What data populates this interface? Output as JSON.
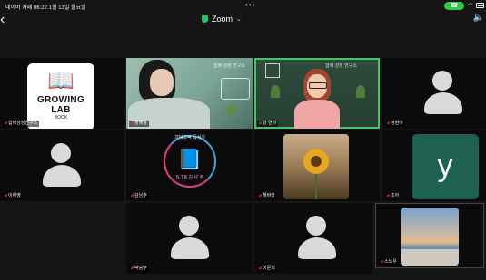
{
  "status_bar": {
    "left": "네이버 카페   06:22   1월 13일 월요일",
    "dots": "•••",
    "call": "☎"
  },
  "header": {
    "back": "‹",
    "app_title": "Zoom",
    "chevron": "⌄",
    "speaker_icon": "speaker-icon"
  },
  "participants": [
    {
      "name": "함께성장연구소",
      "muted": true
    },
    {
      "name": "정해율",
      "muted": true,
      "room_label": "함께 성장 연구소"
    },
    {
      "name": "강 연아",
      "muted": true,
      "room_label": "함께 성장 연구소",
      "active_speaker": true
    },
    {
      "name": "정현아",
      "muted": true
    },
    {
      "name": "이하영",
      "muted": true
    },
    {
      "name": "김남주",
      "muted": true
    },
    {
      "name": "해바라",
      "muted": true
    },
    {
      "name": "조아",
      "muted": true
    },
    {
      "name": "박승주",
      "muted": true
    },
    {
      "name": "이문희",
      "muted": true
    },
    {
      "name": "스노우",
      "muted": true
    }
  ],
  "growing_lab": {
    "icon": "open-book-icon",
    "title": "GROWING LAB",
    "subtitle": "BOOK"
  },
  "ntb_logo": {
    "top": "끄덕끄덕 독서기",
    "bottom": "N.T.B 김 남 주",
    "icon": "reading-person-icon"
  },
  "y_tile": {
    "letter": "y"
  },
  "colors": {
    "active_outline": "#46c463",
    "muted_mic": "#e53935",
    "y_tile_bg": "#1e6150",
    "avatar": "#dadada"
  }
}
